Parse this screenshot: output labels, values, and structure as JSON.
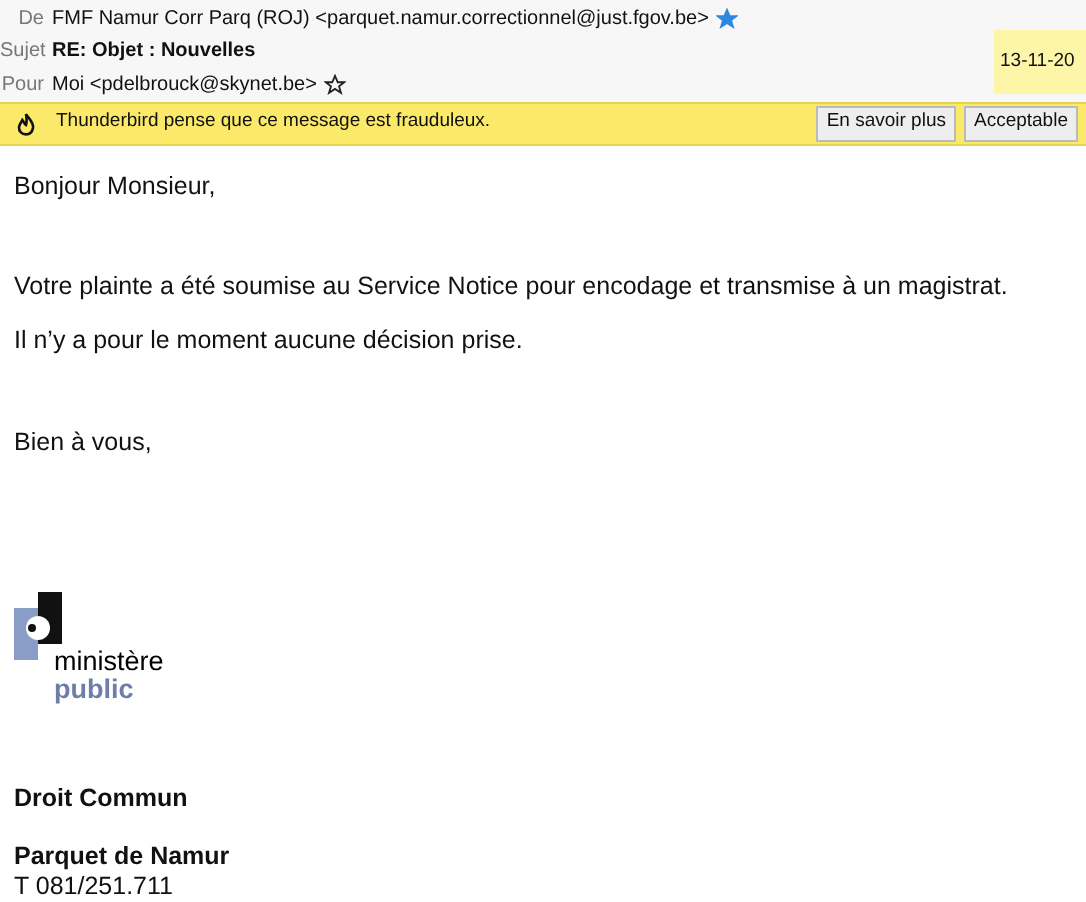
{
  "header": {
    "from": {
      "label": "De",
      "value": "FMF Namur Corr Parq (ROJ) <parquet.namur.correctionnel@just.fgov.be>",
      "starred": true
    },
    "subject": {
      "label": "Sujet",
      "value": "RE: Objet : Nouvelles"
    },
    "to": {
      "label": "Pour",
      "value": "Moi <pdelbrouck@skynet.be>",
      "starred": false
    },
    "date": "13-11-20"
  },
  "notification": {
    "message": "Thunderbird pense que ce message est frauduleux.",
    "buttons": [
      "En savoir plus",
      "Acceptable"
    ]
  },
  "body": {
    "paragraphs": [
      "Bonjour Monsieur,",
      "Votre plainte a été soumise au Service Notice pour encodage et transmise à un magistrat.",
      "Il n’y a pour le moment aucune décision prise.",
      "Bien à vous,"
    ],
    "logo": {
      "line_1": "ministère",
      "line_2": "public"
    },
    "signature": [
      "Droit Commun",
      "Parquet de Namur",
      "T 081/251.711"
    ]
  }
}
